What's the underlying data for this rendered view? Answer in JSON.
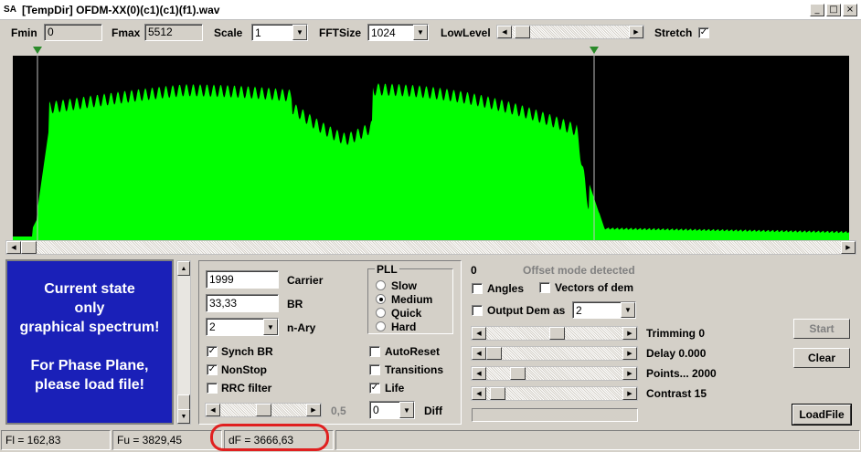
{
  "window": {
    "icon_text": "SA",
    "title": "[TempDir] OFDM-XX(0)(c1)(c1)(f1).wav",
    "btn_min": "_",
    "btn_max": "□",
    "btn_close": "×"
  },
  "toolbar": {
    "fmin_label": "Fmin",
    "fmin_value": "0",
    "fmax_label": "Fmax",
    "fmax_value": "5512",
    "scale_label": "Scale",
    "scale_value": "1",
    "fft_label": "FFTSize",
    "fft_value": "1024",
    "lowlevel_label": "LowLevel",
    "stretch_label": "Stretch",
    "stretch_checked": true,
    "lowlevel_fraction": 0.03
  },
  "spectrum": {
    "bg": "#000000",
    "fill": "#00ff00",
    "left_marker_hz": 162.83,
    "right_marker_hz": 3829.45,
    "fmax_hz": 5512
  },
  "info_panel": {
    "bg": "#1a20b8",
    "line1": "Current state",
    "line2": "only",
    "line3": "graphical spectrum!",
    "line4": "For Phase Plane,",
    "line5": "please load file!"
  },
  "params": {
    "carrier_value": "1999",
    "carrier_label": "Carrier",
    "br_value": "33,33",
    "br_label": "BR",
    "nary_value": "2",
    "nary_label": "n-Ary",
    "synch_label": "Synch BR",
    "synch_checked": true,
    "nonstop_label": "NonStop",
    "nonstop_checked": true,
    "rrc_label": "RRC filter",
    "rrc_checked": false,
    "slider_value": "0,5",
    "slider_fraction": 0.5
  },
  "pll": {
    "title": "PLL",
    "options": [
      "Slow",
      "Medium",
      "Quick",
      "Hard"
    ],
    "selected": "Medium"
  },
  "options": {
    "autoreset_label": "AutoReset",
    "autoreset_checked": false,
    "transitions_label": "Transitions",
    "transitions_checked": false,
    "life_label": "Life",
    "life_checked": true,
    "diff_value": "0",
    "diff_label": "Diff"
  },
  "right": {
    "count_value": "0",
    "offset_text": "Offset mode detected",
    "angles_label": "Angles",
    "angles_checked": false,
    "vectors_label": "Vectors of dem",
    "vectors_checked": false,
    "output_label": "Output Dem as",
    "output_checked": false,
    "output_value": "2",
    "trimming_label": "Trimming 0",
    "trimming_fraction": 0.52,
    "delay_label": "Delay  0.000",
    "delay_fraction": 0.0,
    "points_label": "Points... 2000",
    "points_fraction": 0.2,
    "contrast_label": "Contrast 15",
    "contrast_fraction": 0.03
  },
  "buttons": {
    "start": "Start",
    "clear": "Clear",
    "loadfile": "LoadFile"
  },
  "status": {
    "fl": "Fl = 162,83",
    "fu": "Fu = 3829,45",
    "df": "dF = 3666,63"
  },
  "highlight_color": "#e02020"
}
